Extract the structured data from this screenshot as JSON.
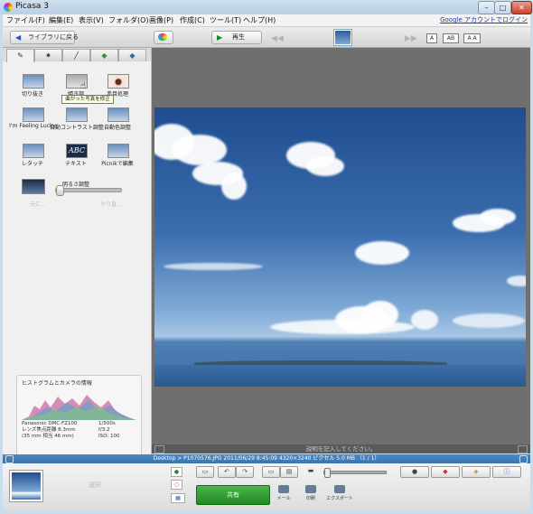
{
  "app": {
    "title": "Picasa 3"
  },
  "window": {
    "min": "–",
    "max": "□",
    "close": "✕"
  },
  "menu": {
    "items": [
      "ファイル(F)",
      "編集(E)",
      "表示(V)",
      "フォルダ(O)",
      "画像(P)",
      "作成(C)",
      "ツール(T)",
      "ヘルプ(H)"
    ],
    "account_link": "Google アカウントでログイン"
  },
  "toolbar": {
    "back_label": "ライブラリに戻る",
    "play_label": "再生",
    "captions": [
      "A",
      "AB",
      "A A"
    ]
  },
  "panel": {
    "tabs": [
      "wrench-icon",
      "sparkle-icon",
      "brush-icon",
      "tint-icon",
      "pen-icon"
    ],
    "tools": [
      {
        "label": "切り抜き",
        "icon": "crop-icon"
      },
      {
        "label": "傾き調",
        "icon": "straighten-icon"
      },
      {
        "label": "赤目処理",
        "icon": "redeye-icon"
      },
      {
        "label": "I'm Feeling Lucky",
        "icon": "lucky-icon"
      },
      {
        "label": "自動コントラスト調整",
        "icon": "auto-contrast-icon"
      },
      {
        "label": "自動色調整",
        "icon": "auto-color-icon"
      },
      {
        "label": "レタッチ",
        "icon": "retouch-icon"
      },
      {
        "label": "テキスト",
        "icon": "text-icon"
      },
      {
        "label": "Picnikで編集",
        "icon": "picnik-icon"
      }
    ],
    "text_icon_glyph": "ABC",
    "tooltip": "曲がった写真を修正",
    "brightness_label": "明るさ調整",
    "undo": "元に…",
    "redo": "やり直…",
    "histogram_title": "ヒストグラムとカメラの情報",
    "exif_left": [
      "Panasonic DMC-FZ100",
      "レンズ焦点距離 8.3mm",
      "(35 mm 相当 46 mm)"
    ],
    "exif_right": [
      "1/500s",
      "f/3.2",
      "ISO: 100"
    ]
  },
  "viewer": {
    "caption_placeholder": "説明を記入してください。"
  },
  "status": {
    "text": "Desktop > P1070576.JPG 2011/06/29 8:45:09 4320×3240 ピクセル 5.0 MB   （1 / 1）"
  },
  "tray": {
    "selection_text": "選択",
    "share_label": "共有",
    "actions": [
      "メール",
      "印刷",
      "エクスポート"
    ]
  },
  "colors": {
    "accent": "#2f6db0",
    "share": "#2a962a"
  }
}
